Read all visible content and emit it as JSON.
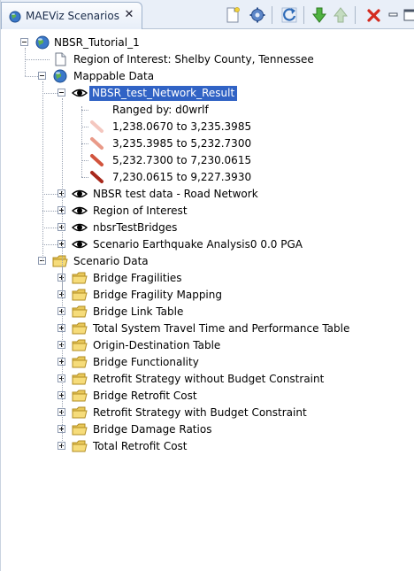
{
  "view": {
    "tab_title": "MAEViz Scenarios",
    "close_glyph": "✕"
  },
  "icons": {
    "tab": "globe-icon",
    "toolbar": [
      "new-document-icon",
      "gear-icon",
      "refresh-icon",
      "move-down-icon",
      "move-up-icon",
      "delete-icon",
      "minimize-icon",
      "maximize-icon"
    ]
  },
  "colors": {
    "selection": "#3163c5",
    "legend": [
      "#f4c7bf",
      "#e99a88",
      "#d2543d",
      "#a8281b"
    ]
  },
  "tree": {
    "root": "NBSR_Tutorial_1",
    "region_of_interest": "Region of Interest: Shelby County, Tennessee",
    "mappable_data": {
      "label": "Mappable Data",
      "result_layer": "NBSR_test_Network_Result",
      "ranged_by": "Ranged by: d0wrlf",
      "ranges": [
        "1,238.0670 to 3,235.3985",
        "3,235.3985 to 5,232.7300",
        "5,232.7300 to 7,230.0615",
        "7,230.0615 to 9,227.3930"
      ],
      "layers": [
        "NBSR test data - Road Network",
        "Region of Interest",
        "nbsrTestBridges",
        "Scenario Earthquake Analysis0 0.0 PGA"
      ]
    },
    "scenario_data": {
      "label": "Scenario Data",
      "items": [
        "Bridge Fragilities",
        "Bridge Fragility Mapping",
        "Bridge Link Table",
        "Total System Travel Time and Performance Table",
        "Origin-Destination Table",
        "Bridge Functionality",
        "Retrofit Strategy without Budget Constraint",
        "Bridge Retrofit Cost",
        "Retrofit Strategy with Budget Constraint",
        "Bridge Damage Ratios",
        "Total Retrofit Cost"
      ]
    }
  }
}
